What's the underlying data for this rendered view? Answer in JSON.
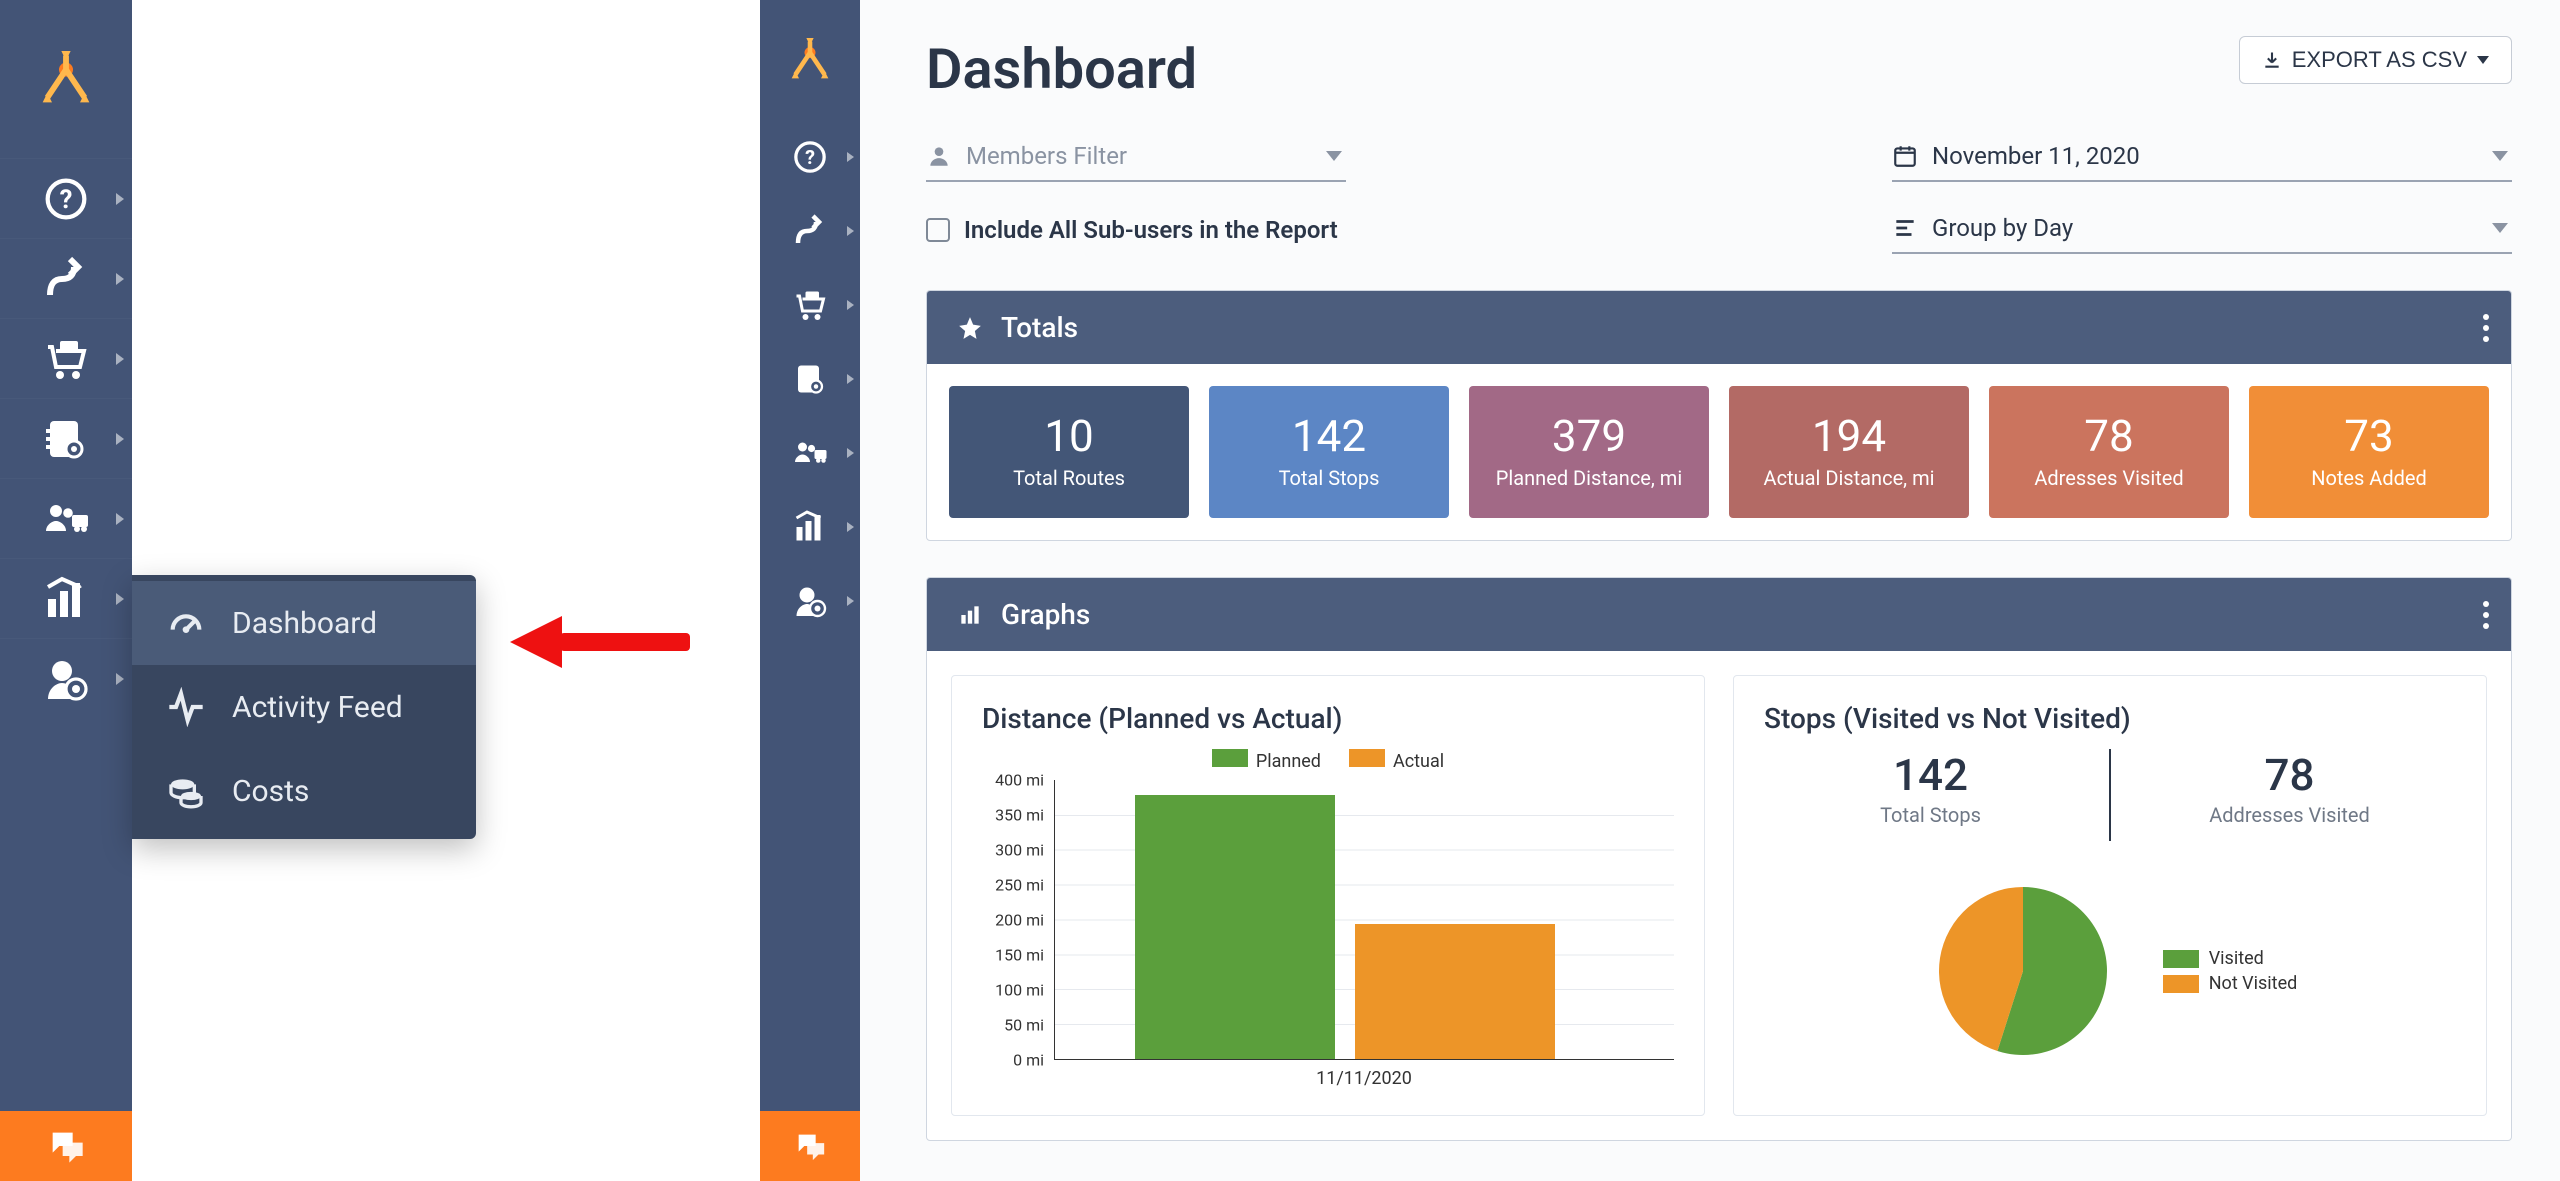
{
  "submenu": {
    "dashboard": "Dashboard",
    "activity_feed": "Activity Feed",
    "costs": "Costs"
  },
  "page": {
    "title": "Dashboard",
    "export_label": "EXPORT AS CSV"
  },
  "filters": {
    "members_placeholder": "Members Filter",
    "date_value": "November 11, 2020",
    "group_value": "Group by Day",
    "include_all_label": "Include All Sub-users in the Report"
  },
  "totals": {
    "header": "Totals",
    "cards": [
      {
        "value": "10",
        "label": "Total Routes",
        "color": "#435677"
      },
      {
        "value": "142",
        "label": "Total Stops",
        "color": "#5c86c5"
      },
      {
        "value": "379",
        "label": "Planned Distance, mi",
        "color": "#a26986"
      },
      {
        "value": "194",
        "label": "Actual Distance, mi",
        "color": "#b36a65"
      },
      {
        "value": "78",
        "label": "Adresses Visited",
        "color": "#cb745e"
      },
      {
        "value": "73",
        "label": "Notes Added",
        "color": "#f18e37"
      }
    ]
  },
  "graphs": {
    "header": "Graphs",
    "bar_title": "Distance (Planned vs Actual)",
    "pie_title": "Stops (Visited vs Not Visited)",
    "pie_stats": {
      "total_stops_value": "142",
      "total_stops_label": "Total Stops",
      "addresses_visited_value": "78",
      "addresses_visited_label": "Addresses Visited"
    },
    "pie_legend": {
      "visited": "Visited",
      "not_visited": "Not Visited"
    },
    "bar_legend": {
      "planned": "Planned",
      "actual": "Actual"
    },
    "bar_xlabel": "11/11/2020",
    "bar_yticks": [
      "0 mi",
      "50 mi",
      "100 mi",
      "150 mi",
      "200 mi",
      "250 mi",
      "300 mi",
      "350 mi",
      "400 mi"
    ]
  },
  "chart_data": [
    {
      "type": "bar",
      "title": "Distance (Planned vs Actual)",
      "categories": [
        "11/11/2020"
      ],
      "series": [
        {
          "name": "Planned",
          "values": [
            379
          ],
          "color": "#5b9f3c"
        },
        {
          "name": "Actual",
          "values": [
            194
          ],
          "color": "#ed9528"
        }
      ],
      "ylabel": "mi",
      "ylim": [
        0,
        400
      ]
    },
    {
      "type": "pie",
      "title": "Stops (Visited vs Not Visited)",
      "series": [
        {
          "name": "Visited",
          "value": 78,
          "color": "#5b9f3c"
        },
        {
          "name": "Not Visited",
          "value": 64,
          "color": "#ed9528"
        }
      ],
      "total": 142
    }
  ]
}
